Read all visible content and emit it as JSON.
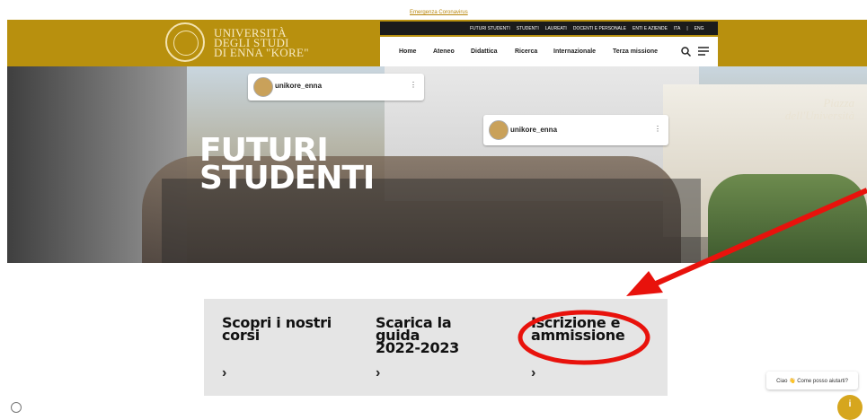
{
  "top": {
    "emergency_link": "Emergenza Coronavirus"
  },
  "logo": {
    "line1": "UNIVERSITÀ",
    "line2": "DEGLI STUDI",
    "line3": "DI ENNA \"KORE\""
  },
  "upper_nav": [
    "FUTURI STUDENTI",
    "STUDENTI",
    "LAUREATI",
    "DOCENTI E PERSONALE",
    "ENTI E AZIENDE",
    "ITA",
    "|",
    "ENG"
  ],
  "main_nav": [
    "Home",
    "Ateneo",
    "Didattica",
    "Ricerca",
    "Internazionale",
    "Terza missione"
  ],
  "hero": {
    "title_line1": "FUTURI",
    "title_line2": "STUDENTI",
    "insta1": "unikore_enna",
    "insta2": "unikore_enna",
    "piazza_line1": "Piazza",
    "piazza_line2": "dell'Università"
  },
  "cards": [
    {
      "lines": [
        "Scopri i nostri",
        "corsi"
      ]
    },
    {
      "lines": [
        "Scarica la",
        "guida",
        "2022-2023"
      ]
    },
    {
      "lines": [
        "Iscrizione e",
        "ammissione"
      ]
    }
  ],
  "chat": {
    "text": "Ciao 👋 Come posso aiutarti?"
  },
  "colors": {
    "brand_gold": "#b8900e",
    "annotation_red": "#e8120c"
  },
  "icons": [
    "search-icon",
    "menu-icon",
    "arrow-right-icon",
    "verified-icon"
  ]
}
